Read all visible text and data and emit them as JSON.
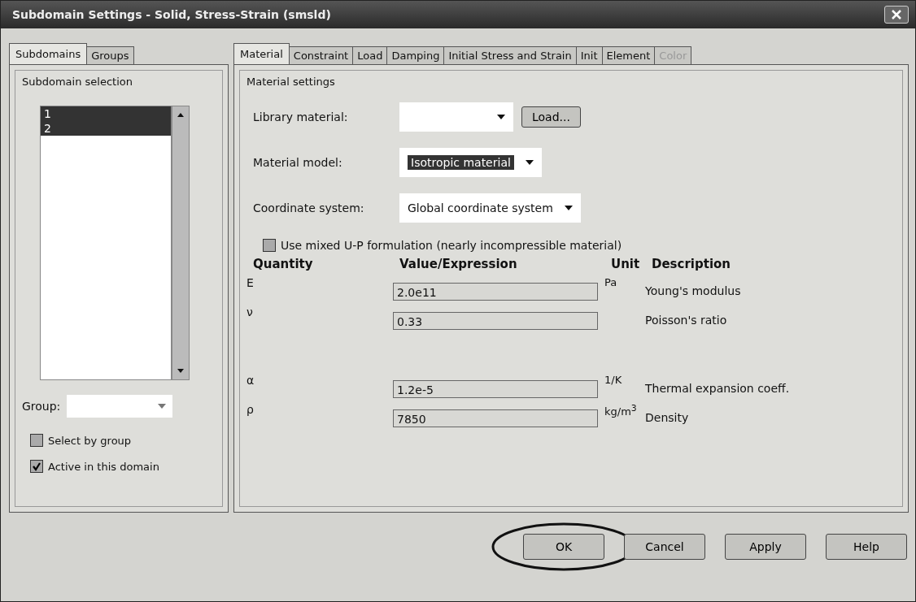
{
  "window": {
    "title": "Subdomain Settings - Solid, Stress-Strain (smsld)"
  },
  "left_tabs": [
    {
      "label": "Subdomains",
      "selected": true
    },
    {
      "label": "Groups",
      "selected": false
    }
  ],
  "subdomain_selection": {
    "title": "Subdomain selection",
    "items": [
      {
        "label": "1",
        "selected": true
      },
      {
        "label": "2",
        "selected": true
      }
    ]
  },
  "group": {
    "label": "Group:"
  },
  "left_checkboxes": [
    {
      "label": "Select by group",
      "checked": false
    },
    {
      "label": "Active in this domain",
      "checked": true
    }
  ],
  "tabs": [
    {
      "label": "Material",
      "selected": true,
      "disabled": false
    },
    {
      "label": "Constraint",
      "selected": false,
      "disabled": false
    },
    {
      "label": "Load",
      "selected": false,
      "disabled": false
    },
    {
      "label": "Damping",
      "selected": false,
      "disabled": false
    },
    {
      "label": "Initial Stress and Strain",
      "selected": false,
      "disabled": false
    },
    {
      "label": "Init",
      "selected": false,
      "disabled": false
    },
    {
      "label": "Element",
      "selected": false,
      "disabled": false
    },
    {
      "label": "Color",
      "selected": false,
      "disabled": true
    }
  ],
  "material_settings": {
    "title": "Material settings",
    "library_material": {
      "label": "Library material:",
      "load_button": "Load..."
    },
    "material_model": {
      "label": "Material model:",
      "value": "Isotropic material"
    },
    "coordinate_system": {
      "label": "Coordinate system:",
      "value": "Global coordinate system"
    },
    "mixed_up": {
      "label": "Use mixed U-P formulation (nearly incompressible material)",
      "checked": false
    }
  },
  "table": {
    "columns": [
      "Quantity",
      "Value/Expression",
      "Unit",
      "Description"
    ],
    "row_groups": [
      [
        {
          "quantity": "E",
          "value": "2.0e11",
          "unit": "Pa",
          "description": "Young's modulus"
        },
        {
          "quantity": "ν",
          "value": "0.33",
          "description": "Poisson's ratio"
        }
      ],
      [
        {
          "quantity": "α",
          "value": "1.2e-5",
          "unit": "1/K",
          "description": "Thermal expansion coeff."
        },
        {
          "quantity": "ρ",
          "value": "7850",
          "unit": "kg/m$^{3}$",
          "description": "Density"
        }
      ]
    ]
  },
  "buttons": [
    {
      "label": "OK",
      "circled": true
    },
    {
      "label": "Cancel",
      "circled": false
    },
    {
      "label": "Apply",
      "circled": false
    },
    {
      "label": "Help",
      "circled": false
    }
  ]
}
